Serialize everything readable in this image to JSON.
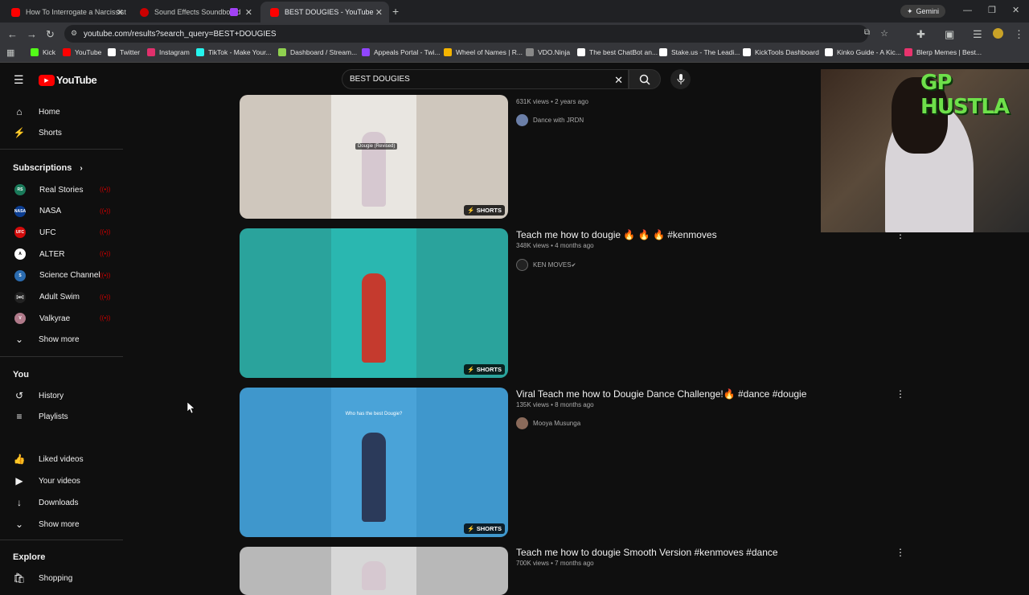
{
  "browser": {
    "tabs": [
      {
        "title": "How To Interrogate a Narcissist",
        "fav_color": "#ff0000"
      },
      {
        "title": "Sound Effects Soundboard",
        "fav_color": "#cc0000"
      },
      {
        "title": "BEST DOUGIES - YouTube",
        "fav_color": "#ff0000"
      }
    ],
    "new_tab": "+",
    "gemini_label": "Gemini",
    "url": "youtube.com/results?search_query=BEST+DOUGIES",
    "bookmarks": [
      {
        "label": "Kick",
        "color": "#53fc18"
      },
      {
        "label": "YouTube",
        "color": "#ff0000"
      },
      {
        "label": "Twitter",
        "color": "#ffffff"
      },
      {
        "label": "Instagram",
        "color": "#e1306c"
      },
      {
        "label": "TikTok - Make Your...",
        "color": "#25f4ee"
      },
      {
        "label": "Dashboard / Stream...",
        "color": "#8fd14f"
      },
      {
        "label": "Appeals Portal - Twi...",
        "color": "#9146ff"
      },
      {
        "label": "Wheel of Names | R...",
        "color": "#f4b400"
      },
      {
        "label": "VDO.Ninja",
        "color": "#888888"
      },
      {
        "label": "The best ChatBot an...",
        "color": "#ffffff"
      },
      {
        "label": "Stake.us - The Leadi...",
        "color": "#ffffff"
      },
      {
        "label": "KickTools Dashboard",
        "color": "#ffffff"
      },
      {
        "label": "Kinko Guide - A Kic...",
        "color": "#ffffff"
      },
      {
        "label": "Blerp Memes | Best...",
        "color": "#e8336d"
      }
    ]
  },
  "youtube": {
    "logo_text": "YouTube",
    "search_value": "BEST DOUGIES",
    "sidebar": {
      "main": [
        {
          "label": "Home",
          "icon": "home-icon",
          "glyph": "⌂"
        },
        {
          "label": "Shorts",
          "icon": "shorts-icon",
          "glyph": "⚡"
        }
      ],
      "subscriptions_title": "Subscriptions",
      "subscriptions": [
        {
          "label": "Real Stories",
          "color": "#1a7a5a",
          "abbr": "RS"
        },
        {
          "label": "NASA",
          "color": "#0b3d91",
          "abbr": "NASA"
        },
        {
          "label": "UFC",
          "color": "#d20a0a",
          "abbr": "UFC"
        },
        {
          "label": "ALTER",
          "color": "#ffffff",
          "abbr": "A"
        },
        {
          "label": "Science Channel",
          "color": "#2b6cb0",
          "abbr": "S"
        },
        {
          "label": "Adult Swim",
          "color": "#222222",
          "abbr": "[as]"
        },
        {
          "label": "Valkyrae",
          "color": "#b07a8a",
          "abbr": "V"
        }
      ],
      "show_more": "Show more",
      "you_title": "You",
      "you_items": [
        {
          "label": "History",
          "glyph": "↺"
        },
        {
          "label": "Playlists",
          "glyph": "≡"
        },
        {
          "label": "Liked videos",
          "glyph": "👍"
        },
        {
          "label": "Your videos",
          "glyph": "▶"
        },
        {
          "label": "Downloads",
          "glyph": "↓"
        },
        {
          "label": "Show more",
          "glyph": "⌄"
        }
      ],
      "explore_title": "Explore",
      "explore_items": [
        {
          "label": "Shopping",
          "glyph": "🛍"
        }
      ]
    },
    "results": [
      {
        "title": "",
        "views": "631K views • 2 years ago",
        "channel": "Dance with JRDN",
        "verified": false,
        "badge": "SHORTS",
        "thumb_bg": "#e9e6e1",
        "thumb_label": "Dougie (Revised)"
      },
      {
        "title": "Teach me how to dougie 🔥 🔥 🔥 #kenmoves",
        "views": "348K views • 4 months ago",
        "channel": "KEN MOVES",
        "verified": true,
        "badge": "SHORTS",
        "thumb_bg": "#2ab7b0",
        "thumb_label": ""
      },
      {
        "title": "Viral Teach me how to Dougie Dance Challenge!🔥 #dance #dougie",
        "views": "135K views • 8 months ago",
        "channel": "Mooya Musunga",
        "verified": false,
        "badge": "SHORTS",
        "thumb_bg": "#4aa3d8",
        "thumb_label": "Who has the best Dougie?"
      },
      {
        "title": "Teach me how to dougie Smooth Version #kenmoves #dance",
        "views": "700K views • 7 months ago",
        "channel": "",
        "verified": false,
        "badge": "",
        "thumb_bg": "#d7d7d7",
        "thumb_label": ""
      }
    ],
    "overlay_text": "GP HUSTLA"
  }
}
